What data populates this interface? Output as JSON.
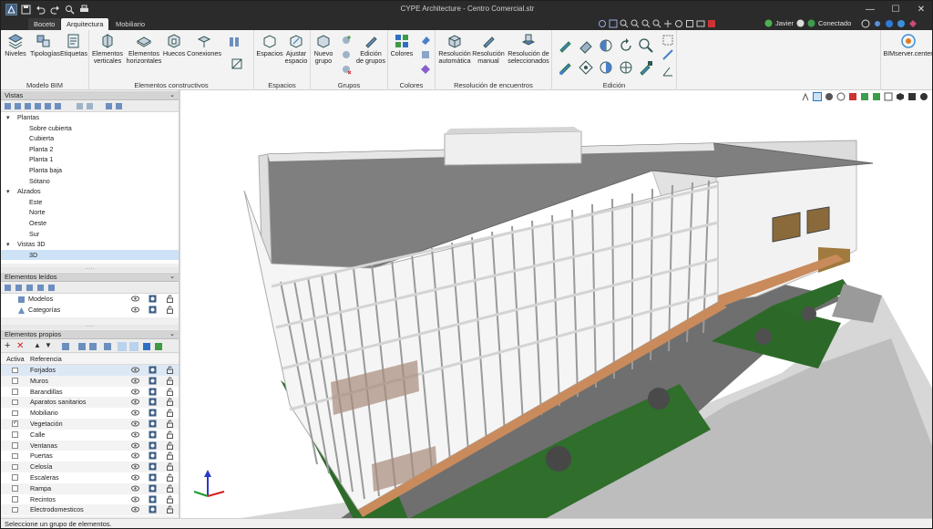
{
  "window": {
    "title": "CYPE Architecture - Centro Comercial.str"
  },
  "tabs": [
    {
      "label": "Boceto",
      "active": false
    },
    {
      "label": "Arquitectura",
      "active": true
    },
    {
      "label": "Mobiliario",
      "active": false
    }
  ],
  "user": {
    "name": "Javier",
    "status": "Conectado"
  },
  "ribbon": {
    "groups": {
      "modelo_bim": "Modelo BIM",
      "elementos_constructivos": "Elementos constructivos",
      "espacios": "Espacios",
      "grupos": "Grupos",
      "colores": "Colores",
      "resolucion": "Resolución de encuentros",
      "edicion": "Edición"
    },
    "buttons": {
      "niveles": "Niveles",
      "tipologias": "Tipologías",
      "etiquetas": "Etiquetas",
      "elementos_verticales_1": "Elementos",
      "elementos_verticales_2": "verticales",
      "elementos_horizontales_1": "Elementos",
      "elementos_horizontales_2": "horizontales",
      "huecos": "Huecos",
      "conexiones": "Conexiones",
      "espacios": "Espacios",
      "ajustar_espacio_1": "Ajustar",
      "ajustar_espacio_2": "espacio",
      "nuevo_grupo_1": "Nuevo",
      "nuevo_grupo_2": "grupo",
      "edicion_grupos_1": "Edición",
      "edicion_grupos_2": "de grupos",
      "colores": "Colores",
      "resolucion_automatica_1": "Resolución",
      "resolucion_automatica_2": "automática",
      "resolucion_manual_1": "Resolución",
      "resolucion_manual_2": "manual",
      "resolucion_seleccionados_1": "Resolución de",
      "resolucion_seleccionados_2": "seleccionados",
      "bimserver": "BIMserver.center"
    }
  },
  "vistas": {
    "header": "Vistas",
    "tree": [
      {
        "label": "Plantas",
        "level": 0,
        "expander": "▾"
      },
      {
        "label": "Sobre cubierta",
        "level": 1
      },
      {
        "label": "Cubierta",
        "level": 1
      },
      {
        "label": "Planta 2",
        "level": 1
      },
      {
        "label": "Planta 1",
        "level": 1
      },
      {
        "label": "Planta baja",
        "level": 1
      },
      {
        "label": "Sótano",
        "level": 1
      },
      {
        "label": "Alzados",
        "level": 0,
        "expander": "▾"
      },
      {
        "label": "Este",
        "level": 1
      },
      {
        "label": "Norte",
        "level": 1
      },
      {
        "label": "Oeste",
        "level": 1
      },
      {
        "label": "Sur",
        "level": 1
      },
      {
        "label": "Vistas 3D",
        "level": 0,
        "expander": "▾"
      },
      {
        "label": "3D",
        "level": 1,
        "selected": true
      }
    ]
  },
  "elementos_leidos": {
    "header": "Elementos leídos",
    "items": [
      {
        "label": "Modelos"
      },
      {
        "label": "Categorías"
      }
    ]
  },
  "elementos_propios": {
    "header": "Elementos propios",
    "columns": {
      "activa": "Activa",
      "referencia": "Referencia"
    },
    "rows": [
      {
        "ref": "Forjados",
        "checked": false
      },
      {
        "ref": "Muros",
        "checked": false
      },
      {
        "ref": "Barandillas",
        "checked": false
      },
      {
        "ref": "Aparatos sanitarios",
        "checked": false
      },
      {
        "ref": "Mobiliario",
        "checked": false
      },
      {
        "ref": "Vegetación",
        "checked": true
      },
      {
        "ref": "Calle",
        "checked": false
      },
      {
        "ref": "Ventanas",
        "checked": false
      },
      {
        "ref": "Puertas",
        "checked": false
      },
      {
        "ref": "Celosía",
        "checked": false
      },
      {
        "ref": "Escaleras",
        "checked": false
      },
      {
        "ref": "Rampa",
        "checked": false
      },
      {
        "ref": "Recintos",
        "checked": false
      },
      {
        "ref": "Electrodomesticos",
        "checked": false
      }
    ]
  },
  "status": {
    "message": "Seleccione un grupo de elementos."
  },
  "colors": {
    "accent": "#1e78c8",
    "titlebar": "#2b2b2b",
    "grass": "#2d6b2a",
    "roof": "#8f8f8f"
  }
}
